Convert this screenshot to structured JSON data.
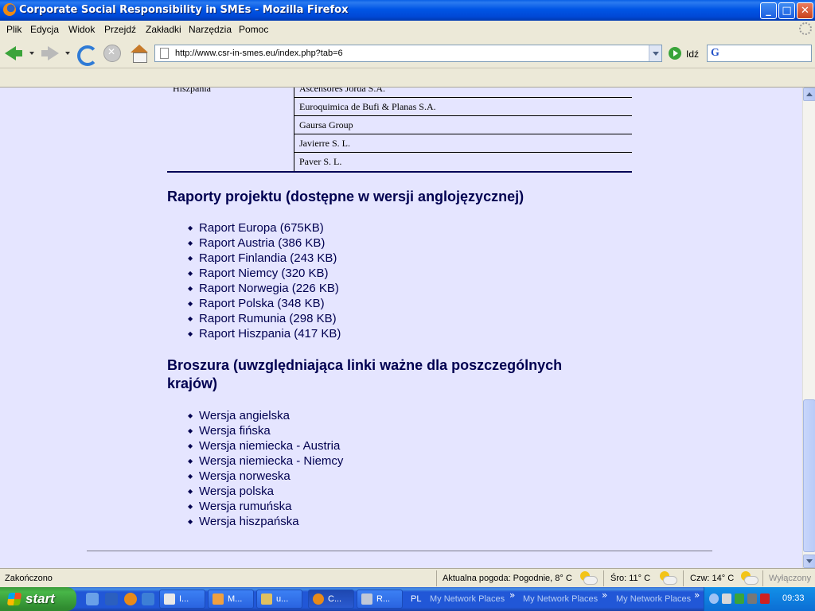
{
  "window": {
    "title": "Corporate Social Responsibility in SMEs - Mozilla Firefox",
    "minimize": "_",
    "maximize": "□",
    "close": "✕"
  },
  "menu": [
    "Plik",
    "Edycja",
    "Widok",
    "Przejdź",
    "Zakładki",
    "Narzędzia",
    "Pomoc"
  ],
  "nav": {
    "url": "http://www.csr-in-smes.eu/index.php?tab=6",
    "go_label": "Idź",
    "search_placeholder": ""
  },
  "content": {
    "country": "Hiszpania",
    "companies": [
      "Ascensores Jordá S.A.",
      "Euroquimica de Bufi & Planas S.A.",
      "Gaursa Group",
      "Javierre S. L.",
      "Paver S. L."
    ],
    "reports_title": "Raporty projektu (dostępne w wersji anglojęzycznej)",
    "reports": [
      "Raport Europa  (675KB)",
      "Raport Austria (386 KB)",
      "Raport Finlandia (243 KB)",
      "Raport Niemcy (320 KB)",
      "Raport Norwegia (226 KB)",
      "Raport Polska (348 KB)",
      "Raport Rumunia (298 KB)",
      "Raport Hiszpania (417 KB)"
    ],
    "brochure_title": "Broszura (uwzględniająca linki ważne dla poszczególnych krajów)",
    "brochures": [
      "Wersja angielska",
      "Wersja fińska",
      "Wersja niemiecka - Austria",
      "Wersja niemiecka - Niemcy",
      "Wersja norweska",
      "Wersja polska",
      "Wersja rumuńska",
      "Wersja hiszpańska"
    ]
  },
  "status": {
    "text": "Zakończono",
    "weather_today": "Aktualna pogoda: Pogodnie, 8° C",
    "weather_wed": "Śro: 11° C",
    "weather_thu": "Czw: 14° C",
    "addon_state": "Wyłączony"
  },
  "taskbar": {
    "start": "start",
    "buttons": [
      {
        "label": "I..."
      },
      {
        "label": "M..."
      },
      {
        "label": "u..."
      },
      {
        "label": "C..."
      },
      {
        "label": "R..."
      }
    ],
    "lang": "PL",
    "network_places": [
      "My Network Places",
      "My Network Places",
      "My Network Places"
    ],
    "clock": "09:33"
  }
}
